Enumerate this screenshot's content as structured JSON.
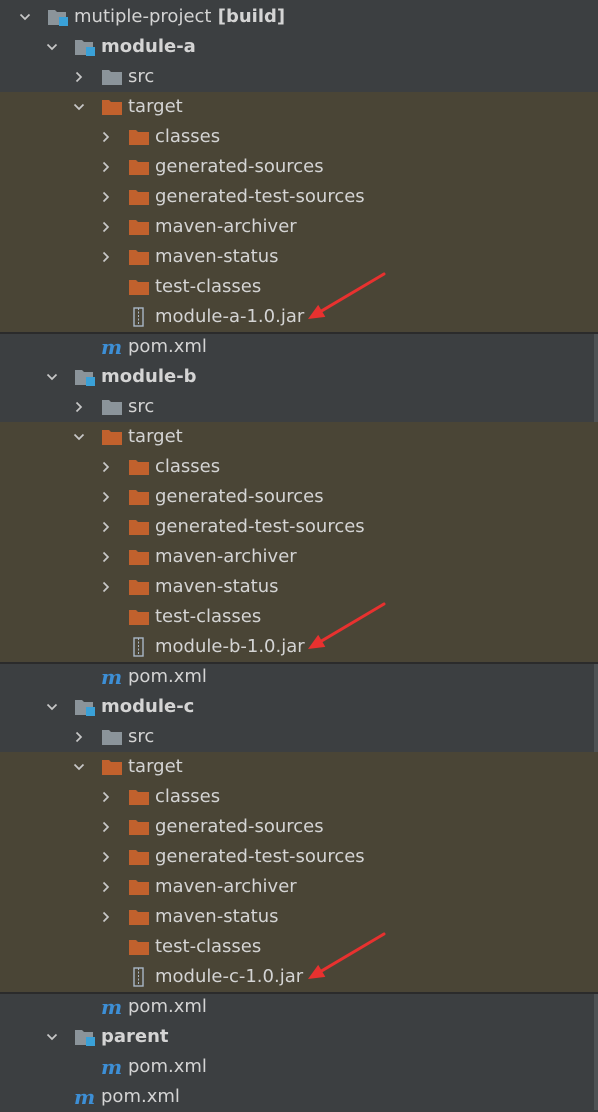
{
  "tree": {
    "root": {
      "label": "mutiple-project",
      "suffix": " [build]"
    },
    "modules": [
      {
        "name": "module-a",
        "src": "src",
        "target": "target",
        "children": [
          "classes",
          "generated-sources",
          "generated-test-sources",
          "maven-archiver",
          "maven-status"
        ],
        "test_classes": "test-classes",
        "jar": "module-a-1.0.jar",
        "pom": "pom.xml"
      },
      {
        "name": "module-b",
        "src": "src",
        "target": "target",
        "children": [
          "classes",
          "generated-sources",
          "generated-test-sources",
          "maven-archiver",
          "maven-status"
        ],
        "test_classes": "test-classes",
        "jar": "module-b-1.0.jar",
        "pom": "pom.xml"
      },
      {
        "name": "module-c",
        "src": "src",
        "target": "target",
        "children": [
          "classes",
          "generated-sources",
          "generated-test-sources",
          "maven-archiver",
          "maven-status"
        ],
        "test_classes": "test-classes",
        "jar": "module-c-1.0.jar",
        "pom": "pom.xml"
      }
    ],
    "parent": {
      "name": "parent",
      "pom": "pom.xml"
    },
    "root_pom": "pom.xml"
  },
  "colors": {
    "background": "#3c3f41",
    "target_highlight": "#4a4536",
    "folder_orange": "#c1612d",
    "folder_gray": "#8b949a",
    "module_square": "#3aa1d8",
    "maven_blue": "#3d8fd6",
    "annotation_arrow": "#e8312f"
  }
}
